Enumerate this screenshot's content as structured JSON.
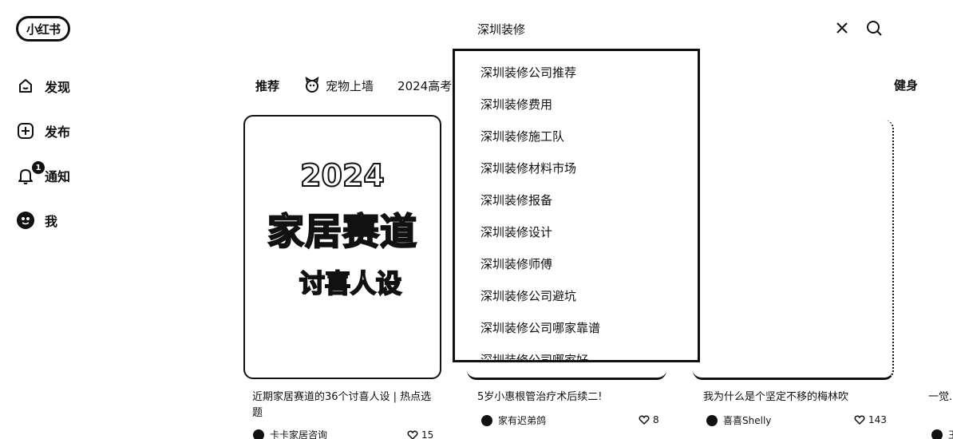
{
  "logo": {
    "text": "小红书"
  },
  "sidebar": {
    "items": [
      {
        "label": "发现",
        "icon": "home-icon"
      },
      {
        "label": "发布",
        "icon": "plus-square-icon"
      },
      {
        "label": "通知",
        "icon": "bell-icon",
        "badge": "1"
      },
      {
        "label": "我",
        "icon": "avatar"
      }
    ]
  },
  "search": {
    "value": "深圳装修"
  },
  "tabs": {
    "items": [
      {
        "label": "推荐"
      },
      {
        "label": "宠物上墙",
        "icon": "pet-icon"
      },
      {
        "label": "2024高考"
      }
    ],
    "right_label": "健身"
  },
  "suggestions": [
    "深圳装修公司推荐",
    "深圳装修费用",
    "深圳装修施工队",
    "深圳装修材料市场",
    "深圳装修报备",
    "深圳装修设计",
    "深圳装修师傅",
    "深圳装修公司避坑",
    "深圳装修公司哪家靠谱",
    "深圳装修公司哪家好"
  ],
  "cards": [
    {
      "cover": {
        "line1": "2024",
        "line2": "家居赛道",
        "line3": "讨喜人设"
      },
      "title": "近期家居赛道的36个讨喜人设 | 热点选题",
      "author": "卡卡家居咨询",
      "likes": "15"
    },
    {
      "title": "5岁小惠根管治疗术后续二!",
      "author": "家有迟弟鸽",
      "likes": "8"
    },
    {
      "title": "我为什么是个坚定不移的梅林吹",
      "author": "喜喜Shelly",
      "likes": "143"
    },
    {
      "title": "一觉...信",
      "author": "王"
    }
  ],
  "colors": {
    "text": "#111111",
    "background": "#ffffff"
  }
}
